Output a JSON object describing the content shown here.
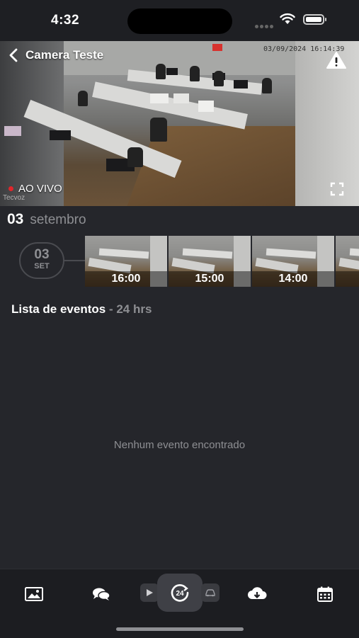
{
  "status_bar": {
    "time": "4:32"
  },
  "video": {
    "title": "Camera Teste",
    "overlay_date": "03/09/2024  16:14:39",
    "live_label": "AO VIVO",
    "watermark": "Tecvoz"
  },
  "date_header": {
    "day": "03",
    "month": "setembro"
  },
  "timeline": {
    "badge_day": "03",
    "badge_month": "SET",
    "thumbnails": [
      {
        "time": "16:00"
      },
      {
        "time": "15:00"
      },
      {
        "time": "14:00"
      },
      {
        "time": ""
      }
    ]
  },
  "events": {
    "title": "Lista de eventos",
    "suffix": "- 24 hrs",
    "empty_message": "Nenhum evento encontrado"
  },
  "bottom_nav": {
    "items": [
      {
        "icon": "gallery-icon"
      },
      {
        "icon": "chat-icon"
      },
      {
        "icon": "play-icon"
      },
      {
        "icon": "24h-icon"
      },
      {
        "icon": "car-icon"
      },
      {
        "icon": "cloud-download-icon"
      },
      {
        "icon": "calendar-icon"
      }
    ]
  },
  "colors": {
    "background": "#25262b",
    "live": "#e0262b",
    "muted": "#8e8f93"
  }
}
